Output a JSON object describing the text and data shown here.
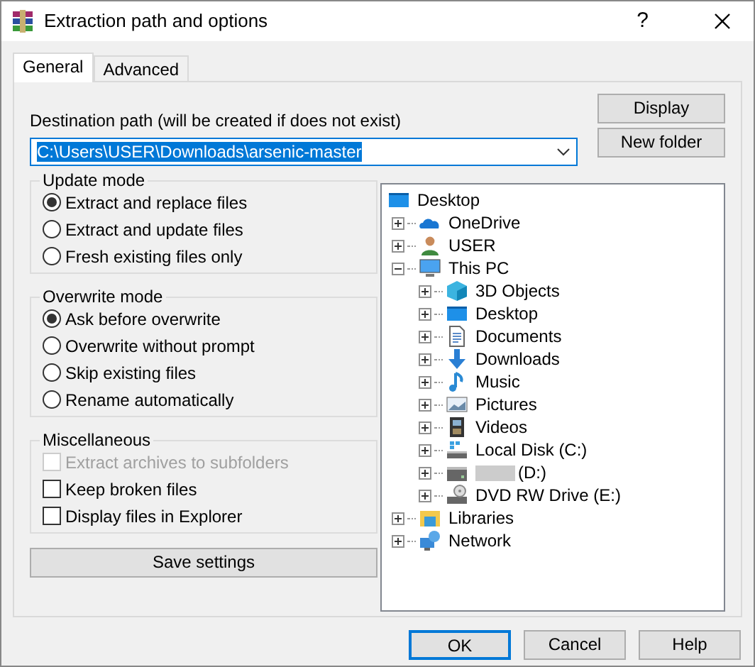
{
  "window": {
    "title": "Extraction path and options",
    "help": "?"
  },
  "tabs": [
    {
      "label": "General",
      "selected": true
    },
    {
      "label": "Advanced",
      "selected": false
    }
  ],
  "destination": {
    "label": "Destination path (will be created if does not exist)",
    "value": "C:\\Users\\USER\\Downloads\\arsenic-master",
    "text_selected": true
  },
  "side_buttons": [
    "Display",
    "New folder"
  ],
  "update_mode": {
    "title": "Update mode",
    "options": [
      {
        "label": "Extract and replace files",
        "selected": true
      },
      {
        "label": "Extract and update files",
        "selected": false
      },
      {
        "label": "Fresh existing files only",
        "selected": false
      }
    ]
  },
  "overwrite_mode": {
    "title": "Overwrite mode",
    "options": [
      {
        "label": "Ask before overwrite",
        "selected": true
      },
      {
        "label": "Overwrite without prompt",
        "selected": false
      },
      {
        "label": "Skip existing files",
        "selected": false
      },
      {
        "label": "Rename automatically",
        "selected": false
      }
    ]
  },
  "miscellaneous": {
    "title": "Miscellaneous",
    "options": [
      {
        "label": "Extract archives to subfolders",
        "checked": false,
        "disabled": true
      },
      {
        "label": "Keep broken files",
        "checked": false,
        "disabled": false
      },
      {
        "label": "Display files in Explorer",
        "checked": false,
        "disabled": false
      }
    ]
  },
  "save_button": "Save settings",
  "tree": [
    {
      "label": "Desktop",
      "kind": "desktop",
      "children": [
        {
          "label": "OneDrive",
          "kind": "cloud",
          "expanded": false
        },
        {
          "label": "USER",
          "kind": "user",
          "expanded": false
        },
        {
          "label": "This PC",
          "kind": "pc",
          "expanded": true,
          "children": [
            {
              "label": "3D Objects",
              "kind": "cube",
              "expanded": false
            },
            {
              "label": "Desktop",
              "kind": "desktop",
              "expanded": false
            },
            {
              "label": "Documents",
              "kind": "doc",
              "expanded": false
            },
            {
              "label": "Downloads",
              "kind": "download",
              "expanded": false
            },
            {
              "label": "Music",
              "kind": "music",
              "expanded": false
            },
            {
              "label": "Pictures",
              "kind": "pictures",
              "expanded": false
            },
            {
              "label": "Videos",
              "kind": "videos",
              "expanded": false
            },
            {
              "label": "Local Disk (C:)",
              "kind": "disk",
              "expanded": false
            },
            {
              "label": "(D:)",
              "kind": "drive",
              "expanded": false,
              "redacted": true
            },
            {
              "label": "DVD RW Drive (E:)",
              "kind": "dvd",
              "expanded": false
            }
          ]
        },
        {
          "label": "Libraries",
          "kind": "libraries",
          "expanded": false
        },
        {
          "label": "Network",
          "kind": "network",
          "expanded": false
        }
      ]
    }
  ],
  "dialog_buttons": [
    {
      "label": "OK",
      "default": true
    },
    {
      "label": "Cancel",
      "default": false
    },
    {
      "label": "Help",
      "default": false
    }
  ]
}
